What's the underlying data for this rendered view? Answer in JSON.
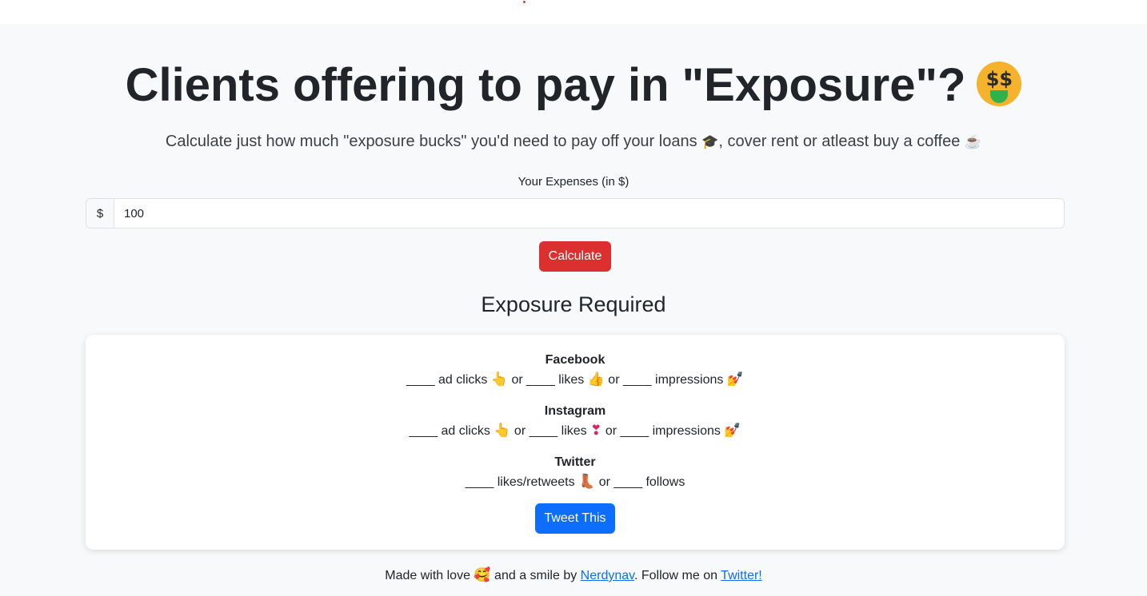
{
  "header": {
    "title": "Clients offering to pay in \"Exposure\"?",
    "title_emoji": "$$",
    "subtitle_part1": "Calculate just how much \"exposure bucks\" you'd need to pay off your loans",
    "subtitle_emoji1": "🎓",
    "subtitle_part2": ", cover rent or atleast buy a coffee",
    "subtitle_emoji2": "☕"
  },
  "form": {
    "label": "Your Expenses (in $)",
    "prefix": "$",
    "expense_value": "100",
    "calculate_label": "Calculate"
  },
  "results": {
    "title": "Exposure Required",
    "blank": "____",
    "or": "or",
    "facebook": {
      "name": "Facebook",
      "ad_clicks": "ad clicks",
      "likes": "likes",
      "impressions": "impressions",
      "emoji_point": "👆",
      "emoji_like": "👍",
      "emoji_impr": "💅"
    },
    "instagram": {
      "name": "Instagram",
      "ad_clicks": "ad clicks",
      "likes": "likes",
      "impressions": "impressions",
      "emoji_point": "👆",
      "emoji_like": "❣",
      "emoji_impr": "💅"
    },
    "twitter": {
      "name": "Twitter",
      "likes_retweets": "likes/retweets",
      "follows": "follows",
      "emoji_boot": "👢"
    },
    "tweet_label": "Tweet This"
  },
  "footer": {
    "made_with": "Made with love",
    "emoji_love": "🥰",
    "and_smile": "and a smile by",
    "author_link": "Nerdynav",
    "follow_text": ". Follow me on",
    "twitter_link": "Twitter!"
  },
  "colors": {
    "background": "#f8f9fa",
    "calculate_button": "#dc2f2f",
    "tweet_button": "#0d6efd",
    "link": "#0d6efd"
  }
}
